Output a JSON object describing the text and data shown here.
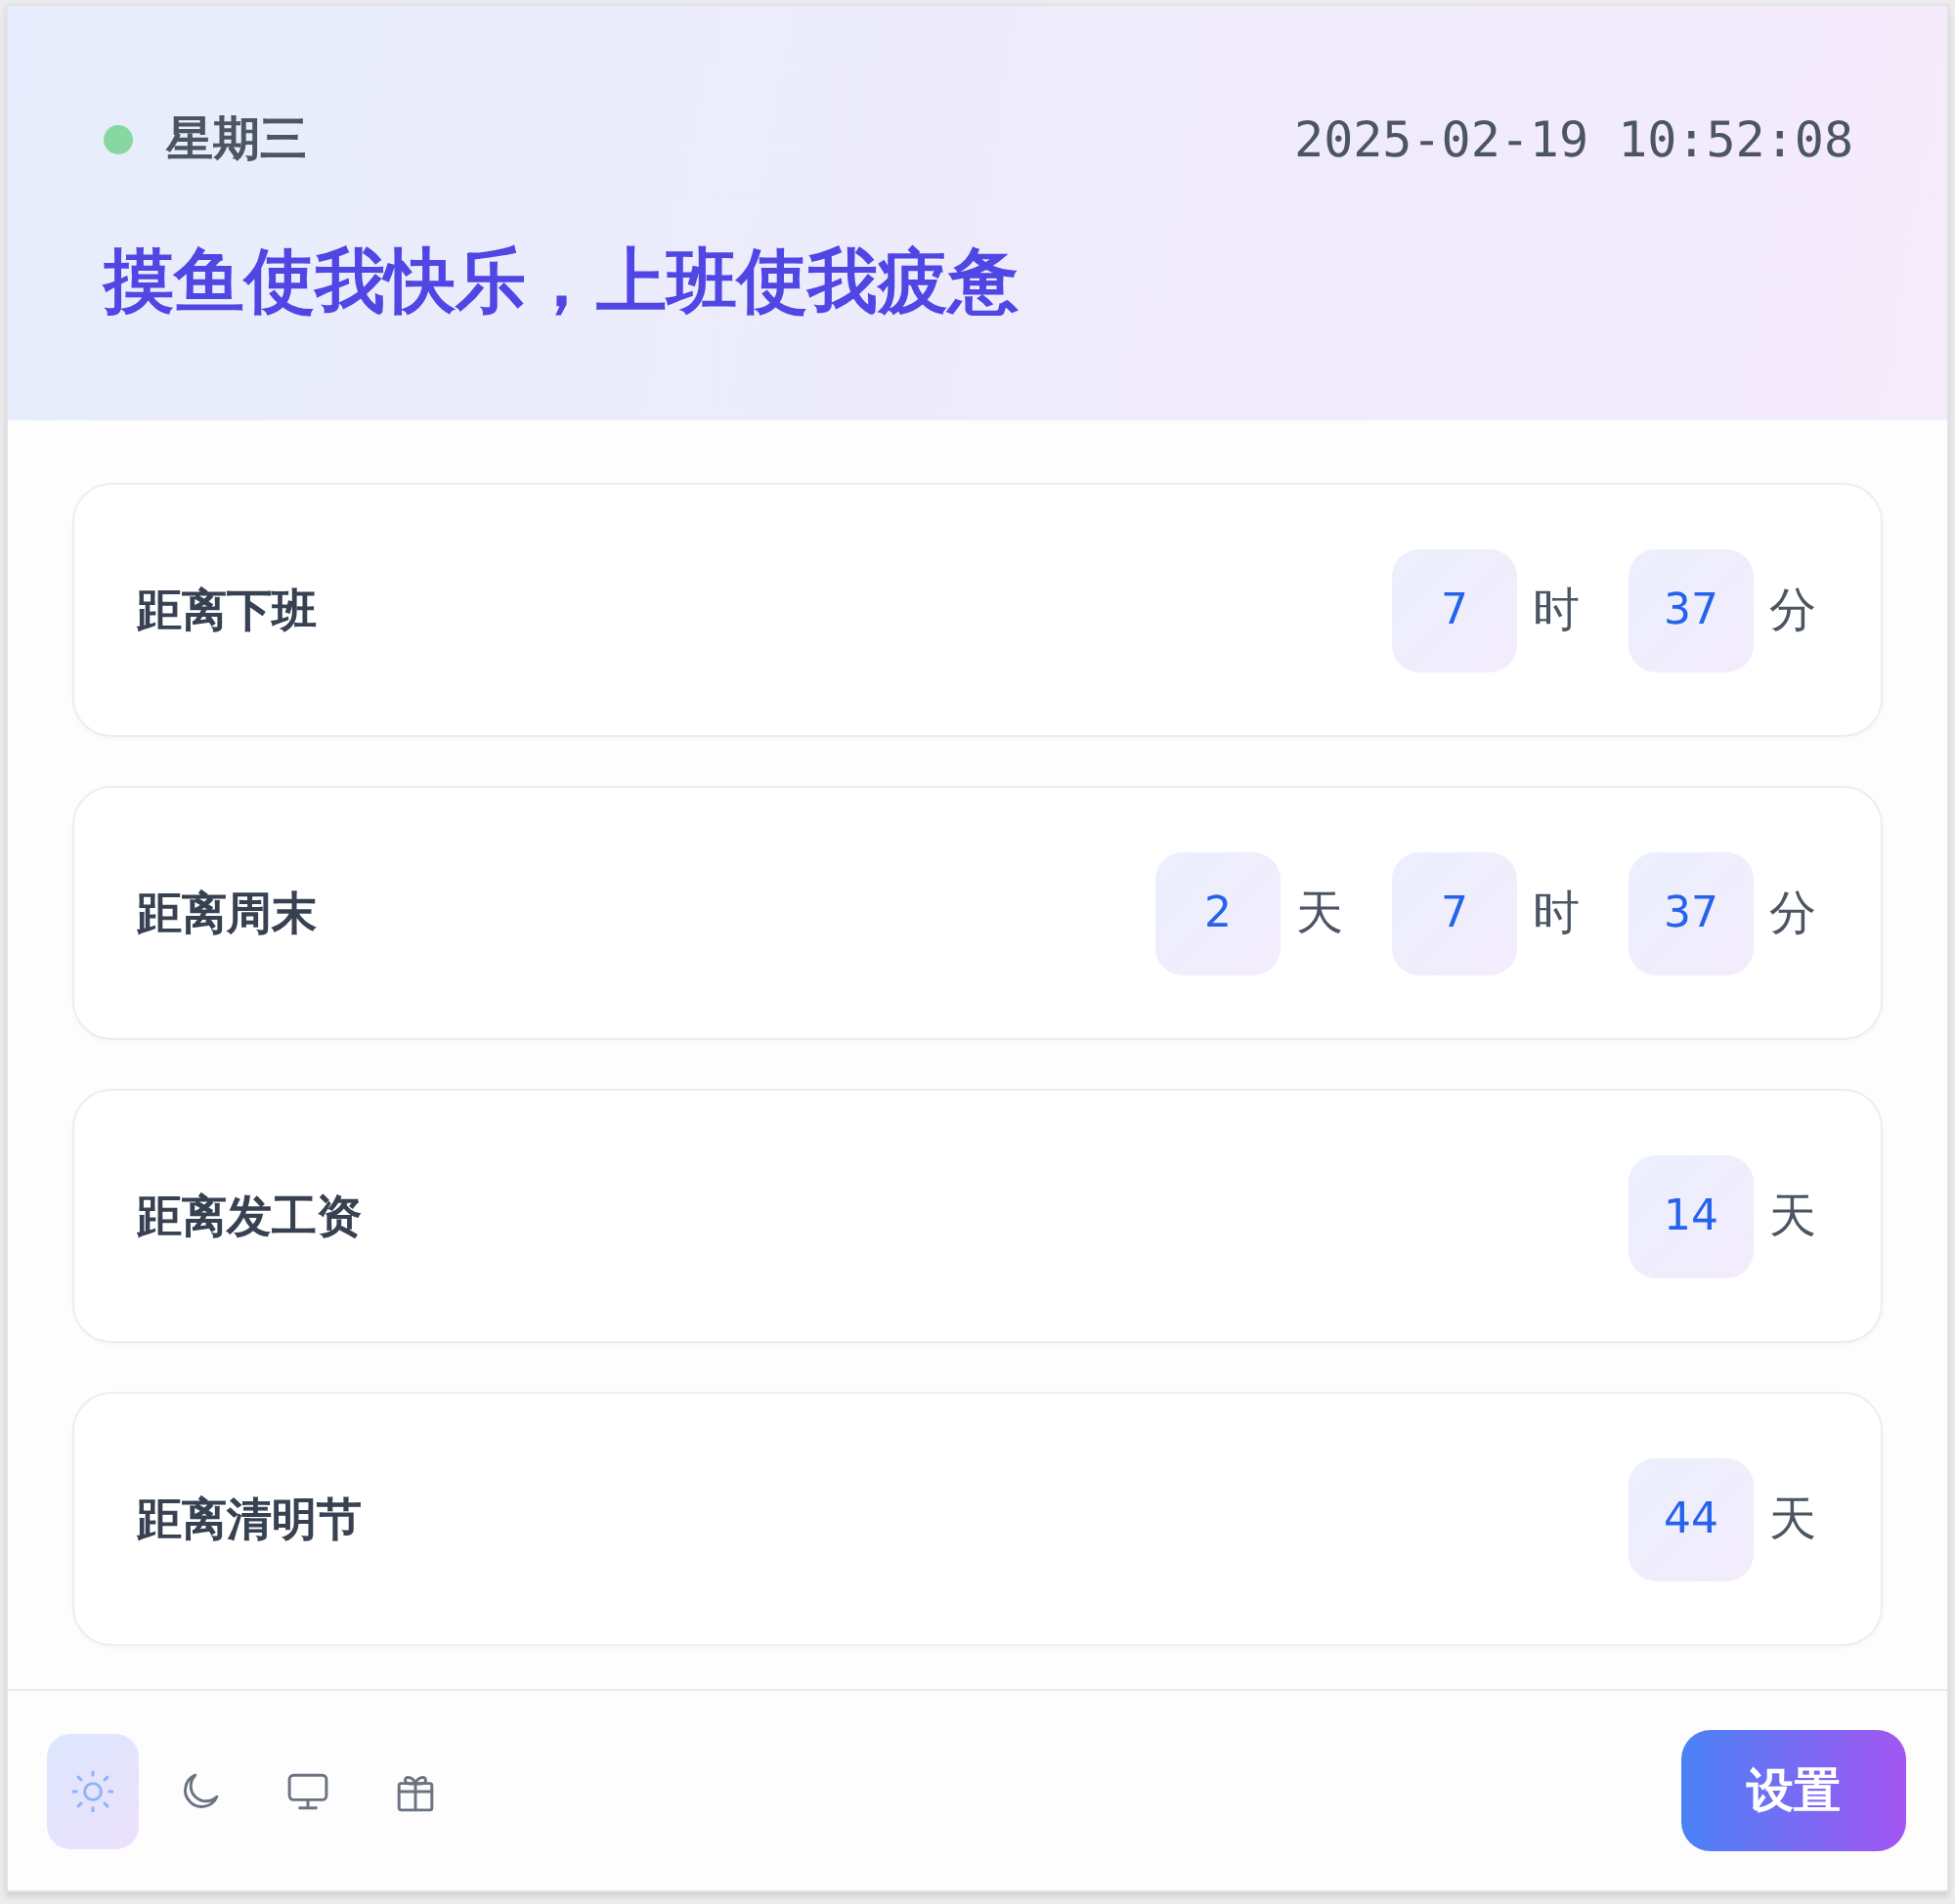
{
  "header": {
    "weekday": "星期三",
    "datetime": "2025-02-19 10:52:08",
    "slogan": "摸鱼使我快乐，上班使我疲惫"
  },
  "countdowns": [
    {
      "label": "距离下班",
      "parts": [
        {
          "value": "7",
          "unit": "时"
        },
        {
          "value": "37",
          "unit": "分"
        }
      ]
    },
    {
      "label": "距离周末",
      "parts": [
        {
          "value": "2",
          "unit": "天"
        },
        {
          "value": "7",
          "unit": "时"
        },
        {
          "value": "37",
          "unit": "分"
        }
      ]
    },
    {
      "label": "距离发工资",
      "parts": [
        {
          "value": "14",
          "unit": "天"
        }
      ]
    },
    {
      "label": "距离清明节",
      "parts": [
        {
          "value": "44",
          "unit": "天"
        }
      ]
    }
  ],
  "footer": {
    "icon_buttons": [
      {
        "kind": "sun",
        "selected": true
      },
      {
        "kind": "moon",
        "selected": false
      },
      {
        "kind": "monitor",
        "selected": false
      },
      {
        "kind": "gift",
        "selected": false
      }
    ],
    "settings_button": "设置"
  }
}
